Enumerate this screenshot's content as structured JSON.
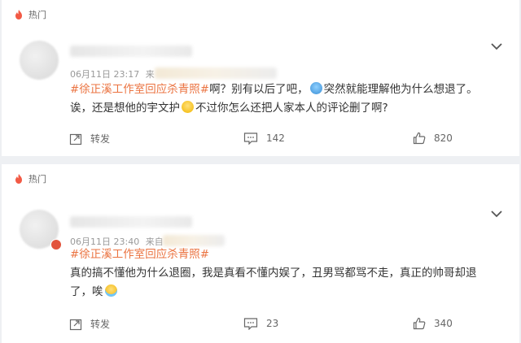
{
  "comments": [
    {
      "hot_label": "热门",
      "date": "06月11日 23:17",
      "source_prefix": "来",
      "content": {
        "topic": "#徐正溪工作室回应杀青照#",
        "part1": "啊？别有以后了吧，",
        "part2": "突然就能理解他为什么想退了。",
        "line2a": "诶，还是想他的宇文护",
        "line2b": "不过你怎么还把人家本人的评论删了啊?"
      },
      "emojis": [
        "funny-face-emoji",
        "teary-face-emoji"
      ],
      "actions": {
        "repost": "转发",
        "comments": "142",
        "likes": "820"
      }
    },
    {
      "hot_label": "热门",
      "date": "06月11日 23:40",
      "source_prefix": "来自",
      "content": {
        "topic": "#徐正溪工作室回应杀青照#",
        "line1": "真的搞不懂他为什么退圈，我是真看不懂内娱了，丑男骂都骂不走，真正的帅哥却退",
        "line2": "了，唉"
      },
      "emojis": [
        "crying-face-emoji"
      ],
      "actions": {
        "repost": "转发",
        "comments": "23",
        "likes": "340"
      }
    }
  ],
  "colors": {
    "topic": "#eb7340",
    "hot_icon": "#f25a45",
    "meta": "#999999",
    "background": "#eef0f3"
  },
  "icons": [
    "fire-icon",
    "chevron-down-icon",
    "repost-icon",
    "comment-icon",
    "like-icon"
  ]
}
